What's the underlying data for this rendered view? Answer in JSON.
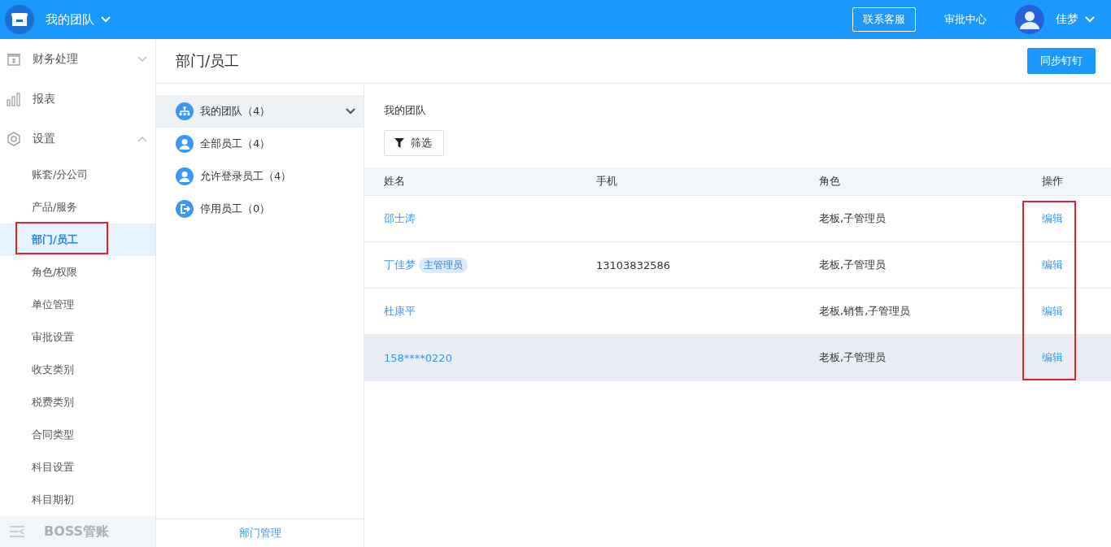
{
  "topbar": {
    "team": "我的团队",
    "links": [
      {
        "label": "联系客服",
        "kind": "outlined"
      },
      {
        "label": "审批中心",
        "kind": "plain"
      }
    ],
    "user": "佳梦"
  },
  "sidebar": {
    "items": [
      {
        "label": "财务处理",
        "kind": "finance",
        "expanded": false
      },
      {
        "label": "报表",
        "kind": "chart"
      },
      {
        "label": "设置",
        "kind": "gear",
        "expanded": true,
        "children": [
          {
            "label": "账套/分公司",
            "selected": false,
            "highlighted": false
          },
          {
            "label": "产品/服务",
            "selected": false,
            "highlighted": false
          },
          {
            "label": "部门/员工",
            "selected": true,
            "highlighted": true
          },
          {
            "label": "角色/权限",
            "selected": false,
            "highlighted": false
          },
          {
            "label": "单位管理",
            "selected": false,
            "highlighted": false
          },
          {
            "label": "审批设置",
            "selected": false,
            "highlighted": false
          },
          {
            "label": "收支类别",
            "selected": false,
            "highlighted": false
          },
          {
            "label": "税费类别",
            "selected": false,
            "highlighted": false
          },
          {
            "label": "合同类型",
            "selected": false,
            "highlighted": false
          },
          {
            "label": "科目设置",
            "selected": false,
            "highlighted": false
          },
          {
            "label": "科目期初",
            "selected": false,
            "highlighted": false
          }
        ]
      }
    ],
    "footer": {
      "label": "BOSS管账",
      "disabled": true
    }
  },
  "page": {
    "title": "部门/员工",
    "action": "同步钉钉"
  },
  "groups": {
    "items": [
      {
        "label": "我的团队（4）",
        "kind": "org",
        "selected": true
      },
      {
        "label": "全部员工（4）",
        "kind": "person",
        "selected": false
      },
      {
        "label": "允许登录员工（4）",
        "kind": "person",
        "selected": false
      },
      {
        "label": "停用员工（0）",
        "kind": "exit",
        "selected": false
      }
    ],
    "footer": "部门管理"
  },
  "content": {
    "heading": "我的团队",
    "filter": "筛选",
    "table": {
      "columns": [
        "姓名",
        "手机",
        "角色",
        "操作"
      ],
      "rows": [
        {
          "name": "邵士涛",
          "role": "老板,子管理员",
          "action": "编辑",
          "action_highlighted": true,
          "hovered": false
        },
        {
          "name": "丁佳梦",
          "badge": "主管理员",
          "phone": "13103832586",
          "role": "老板,子管理员",
          "action": "编辑",
          "action_highlighted": true,
          "hovered": false
        },
        {
          "name": "杜康平",
          "role": "老板,销售,子管理员",
          "action": "编辑",
          "action_highlighted": true,
          "hovered": false
        },
        {
          "name": "158****0220",
          "role": "老板,子管理员",
          "action": "编辑",
          "action_highlighted": true,
          "hovered": true
        }
      ]
    }
  }
}
